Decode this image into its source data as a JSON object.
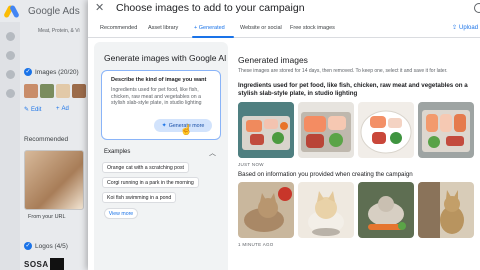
{
  "background": {
    "app_name": "Google Ads",
    "subtitle": "Meat, Protein, & Vi",
    "images_section": "Images (20/20)",
    "edit_label": "Edit",
    "add_label": "Ad",
    "recommended_label": "Recommended",
    "from_url_label": "From your URL",
    "logos_section": "Logos (4/5)",
    "brand_text": "SOSA"
  },
  "dialog": {
    "title": "Choose images to add to your campaign",
    "tabs": [
      {
        "label": "Recommended"
      },
      {
        "label": "Asset library"
      },
      {
        "label": "+ Generated"
      },
      {
        "label": "Website or social"
      },
      {
        "label": "Free stock images"
      }
    ],
    "active_tab": "+ Generated",
    "upload_label": "Upload"
  },
  "generator": {
    "title": "Generate images with Google AI",
    "prompt_label": "Describe the kind of image you want",
    "prompt_text": "Ingredients used for pet food, like fish, chicken, raw meat and vegetables on a stylish slab-style plate, in studio lighting",
    "generate_button": "Generate more",
    "examples_label": "Examples",
    "examples": [
      "Orange cat with a scratching post",
      "Corgi running in a park in the morning",
      "Koi fish swimming in a pond"
    ],
    "view_more": "View more"
  },
  "results": {
    "title": "Generated images",
    "note": "These images are stored for 14 days, then removed. To keep one, select it and save it for later.",
    "group1_heading": "Ingredients used for pet food, like fish, chicken, raw meat and vegetables on a stylish slab-style plate, in studio lighting",
    "group1_time": "JUST NOW",
    "group2_heading": "Based on information you provided when creating the campaign",
    "group2_time": "1 MINUTE AGO"
  },
  "colors": {
    "accent": "#1a73e8",
    "prompt_border": "#8ab4f8",
    "generate_button_bg": "#d2e3fc",
    "panel_bg": "#f1f3f4"
  }
}
